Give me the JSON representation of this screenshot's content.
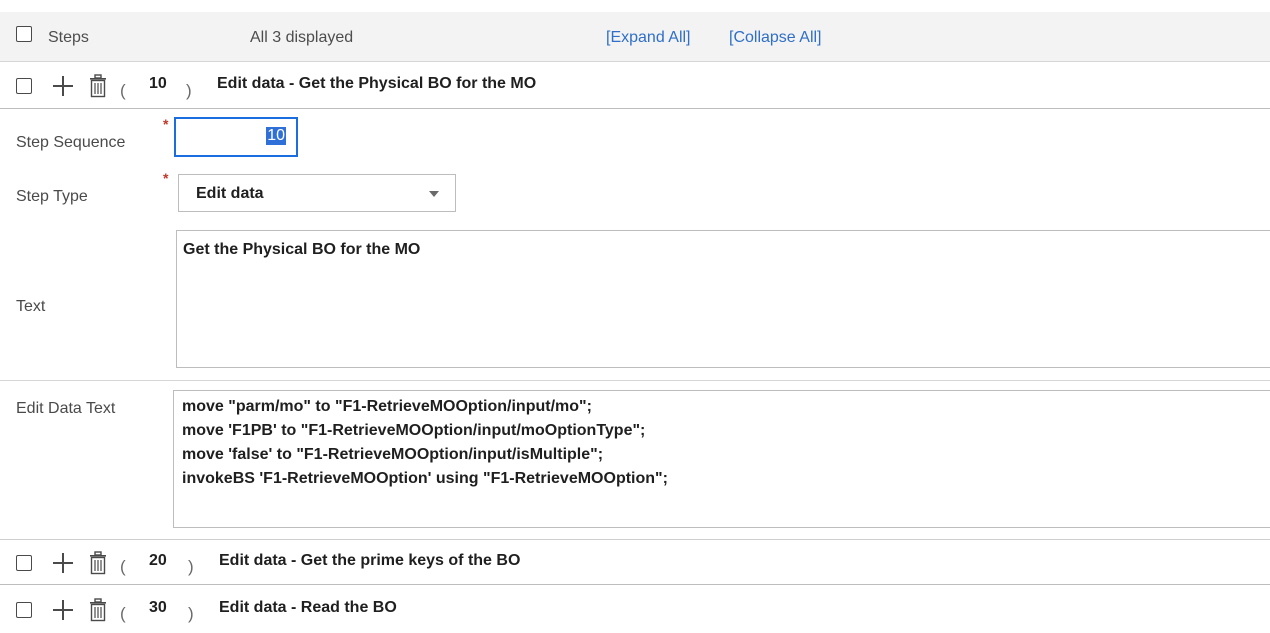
{
  "header": {
    "steps_label": "Steps",
    "displayed_text": "All 3 displayed",
    "expand_all": "[Expand All]",
    "collapse_all": "[Collapse All]"
  },
  "steps": [
    {
      "seq": "10",
      "description": "Edit data - Get the Physical BO for the MO"
    },
    {
      "seq": "20",
      "description": "Edit data - Get the prime keys of the BO"
    },
    {
      "seq": "30",
      "description": "Edit data - Read the BO"
    }
  ],
  "paren_open": "(",
  "paren_close": ")",
  "detail": {
    "step_sequence_label": "Step Sequence",
    "step_sequence_value": "10",
    "step_type_label": "Step Type",
    "step_type_value": "Edit data",
    "text_label": "Text",
    "text_value": "Get the Physical BO for the MO",
    "edit_data_text_label": "Edit Data Text",
    "edit_data_lines": [
      "move \"parm/mo\" to \"F1-RetrieveMOOption/input/mo\";",
      "move 'F1PB' to \"F1-RetrieveMOOption/input/moOptionType\";",
      "move 'false' to \"F1-RetrieveMOOption/input/isMultiple\";",
      "invokeBS 'F1-RetrieveMOOption' using \"F1-RetrieveMOOption\";"
    ],
    "required_mark": "*"
  },
  "icons": {
    "add": "plus-icon",
    "delete": "trash-icon",
    "dropdown": "chevron-down-icon"
  },
  "colors": {
    "link": "#2f6fc7",
    "focus_border": "#1a6ee0",
    "required": "#c0392b"
  }
}
